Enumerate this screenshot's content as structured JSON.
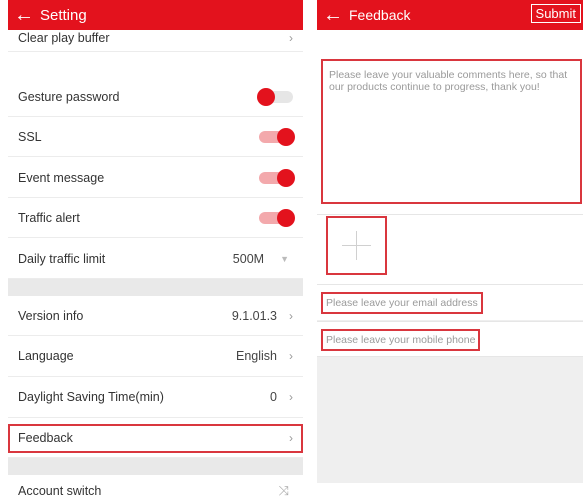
{
  "settings": {
    "title": "Setting",
    "back_glyph": "←",
    "clear_buffer": "Clear play buffer",
    "gesture_password": {
      "label": "Gesture password",
      "enabled": false
    },
    "ssl": {
      "label": "SSL",
      "enabled": true
    },
    "event_message": {
      "label": "Event message",
      "enabled": true
    },
    "traffic_alert": {
      "label": "Traffic alert",
      "enabled": true
    },
    "daily_traffic_limit": {
      "label": "Daily traffic limit",
      "value": "500M"
    },
    "version_info": {
      "label": "Version info",
      "value": "9.1.01.3"
    },
    "language": {
      "label": "Language",
      "value": "English"
    },
    "dst": {
      "label": "Daylight Saving Time(min)",
      "value": "0"
    },
    "feedback": "Feedback",
    "account_switch": "Account switch",
    "chevron_glyph": "›",
    "select_glyph": "▼",
    "switch_glyph": "⤨"
  },
  "feedback_screen": {
    "title": "Feedback",
    "back_glyph": "←",
    "submit_label": "Submit",
    "comment_placeholder": "Please leave your valuable comments here, so that our products continue to progress, thank you!",
    "email_placeholder": "Please leave your email address",
    "phone_placeholder": "Please leave your mobile phone"
  },
  "colors": {
    "accent": "#e3121d",
    "highlight": "#d9363e"
  }
}
